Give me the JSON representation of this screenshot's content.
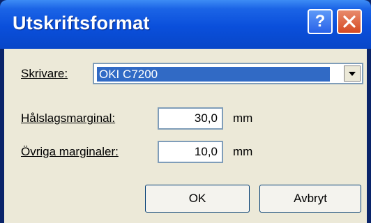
{
  "window": {
    "title": "Utskriftsformat"
  },
  "titlebar": {
    "help_label": "?"
  },
  "printer": {
    "label": "Skrivare:",
    "value": "OKI C7200"
  },
  "hole_margin": {
    "label": "Hålslagsmarginal:",
    "value": "30,0",
    "unit": "mm"
  },
  "other_margins": {
    "label": "Övriga marginaler:",
    "value": "10,0",
    "unit": "mm"
  },
  "buttons": {
    "ok": "OK",
    "cancel": "Avbryt"
  },
  "icons": {
    "help": "help-icon",
    "close": "close-icon",
    "dropdown": "chevron-down-icon"
  },
  "colors": {
    "titlebar": "#0a4fdb",
    "selection": "#316ac5",
    "dialog_bg": "#ece9d8",
    "close_button": "#d54a23"
  }
}
